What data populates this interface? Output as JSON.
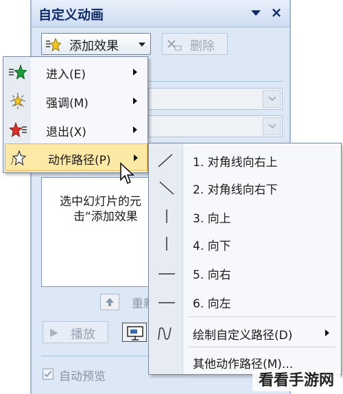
{
  "pane": {
    "title": "自定义动画",
    "close_glyph": "×",
    "add_effect_label": "添加效果",
    "delete_label": "删除",
    "list_hint_line1": "选中幻灯片的元",
    "list_hint_line2": "击“添加效果",
    "reorder_label": "重新",
    "play_label": "播放",
    "autopreview_label": "自动预览",
    "autopreview_checked": true
  },
  "effect_menu": {
    "items": [
      {
        "label": "进入(E)",
        "icon": "entrance-star-icon",
        "color": "#1f9a3a"
      },
      {
        "label": "强调(M)",
        "icon": "emphasis-star-icon",
        "color": "#f2c81e"
      },
      {
        "label": "退出(X)",
        "icon": "exit-star-icon",
        "color": "#d9302a"
      },
      {
        "label": "动作路径(P)",
        "icon": "motion-path-star-icon",
        "color": "#ffffff",
        "active": true
      }
    ]
  },
  "motion_path_menu": {
    "items": [
      {
        "label": "1. 对角线向右上",
        "icon": "diagonal-up-right-icon"
      },
      {
        "label": "2. 对角线向右下",
        "icon": "diagonal-down-right-icon"
      },
      {
        "label": "3. 向上",
        "icon": "line-up-icon"
      },
      {
        "label": "4. 向下",
        "icon": "line-down-icon"
      },
      {
        "label": "5. 向右",
        "icon": "line-right-icon"
      },
      {
        "label": "6. 向左",
        "icon": "line-left-icon"
      },
      {
        "label": "绘制自定义路径(D)",
        "icon": "custom-path-icon"
      },
      {
        "label": "其他动作路径(M)...",
        "icon": ""
      }
    ]
  },
  "watermark": "看看手游网"
}
